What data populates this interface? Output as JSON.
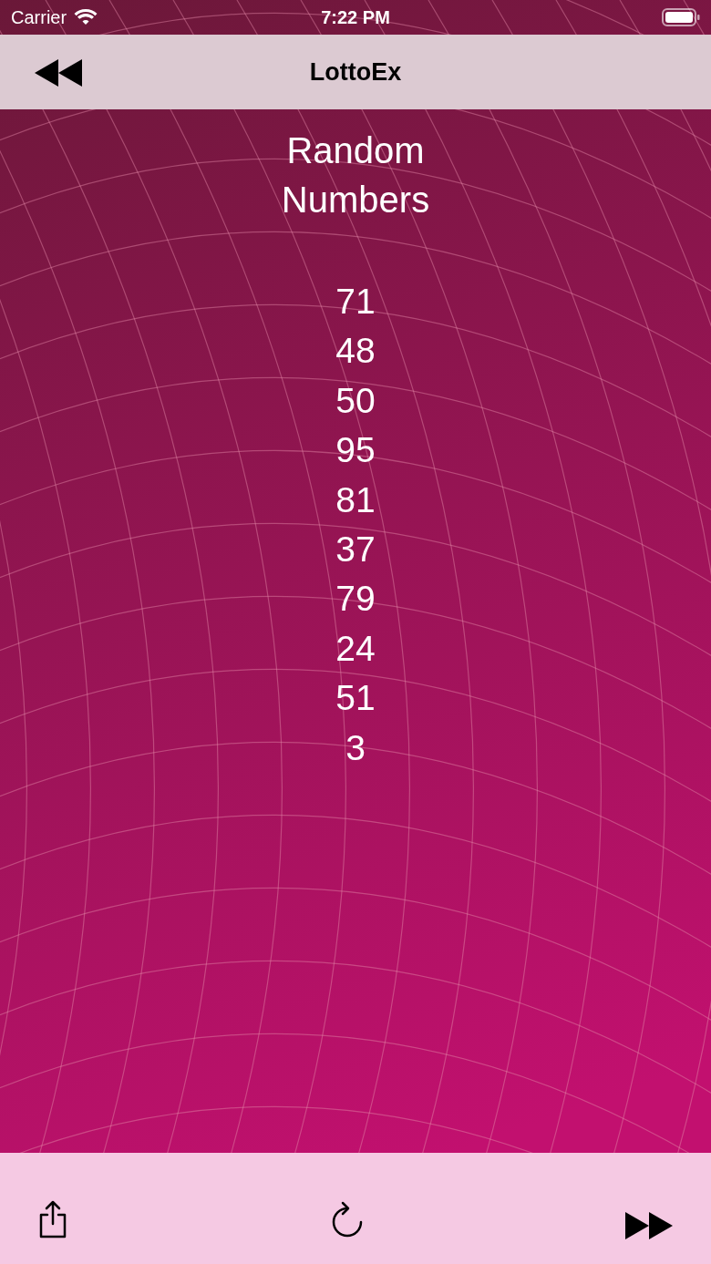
{
  "status_bar": {
    "carrier": "Carrier",
    "time": "7:22 PM"
  },
  "nav_bar": {
    "title": "LottoEx"
  },
  "heading": "Random Numbers",
  "numbers": [
    "71",
    "48",
    "50",
    "95",
    "81",
    "37",
    "79",
    "24",
    "51",
    "3"
  ]
}
